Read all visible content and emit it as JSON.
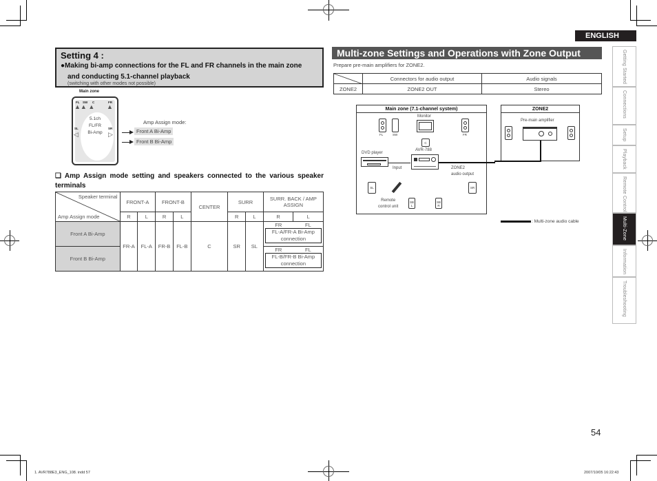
{
  "setting": {
    "title": "Setting 4 :",
    "bullet": "●",
    "line1": "Making bi-amp connections for the FL and FR channels in the main zone",
    "line2": "and conducting 5.1-channel playback",
    "note": "(switching with other modes not possible)"
  },
  "main_zone_mini": {
    "label": "Main zone",
    "speakers": [
      "FL",
      "SW",
      "C",
      "FR",
      "SL",
      "SR"
    ],
    "center_text": [
      "5.1ch",
      "FL/FR",
      "Bi-Amp"
    ]
  },
  "amp_assign": {
    "label": "Amp Assign mode:",
    "options": [
      "Front A Bi-Amp",
      "Front B Bi-Amp"
    ]
  },
  "assign_heading": {
    "checkbox": "❑",
    "text": "Amp Assign mode setting and speakers connected to the various speaker terminals"
  },
  "speaker_table": {
    "corner_top": "Speaker terminal",
    "corner_bottom": "Amp Assign mode",
    "headers": [
      "FRONT-A",
      "FRONT-B",
      "CENTER",
      "SURR",
      "SURR. BACK / AMP ASSIGN"
    ],
    "sub_headers": [
      "R",
      "L",
      "R",
      "L",
      "R",
      "L",
      "R",
      "L"
    ],
    "rows": [
      {
        "mode": "Front A Bi-Amp",
        "sb_r": "FR",
        "sb_l": "FL",
        "connection": "FL-A/FR-A Bi-Amp connection"
      },
      {
        "mode": "Front B Bi-Amp",
        "sb_r": "FR",
        "sb_l": "FL",
        "connection": "FL-B/FR-B Bi-Amp connection"
      }
    ],
    "shared": [
      "FR-A",
      "FL-A",
      "FR-B",
      "FL-B",
      "C",
      "SR",
      "SL"
    ]
  },
  "right": {
    "title": "Multi-zone Settings and Operations with Zone Output",
    "prepare": "Prepare pre-main amplifiers for ZONE2.",
    "zone_table": {
      "headers": [
        "Connectors for audio output",
        "Audio signals"
      ],
      "row": [
        "ZONE2",
        "ZONE2 OUT",
        "Stereo"
      ]
    },
    "diagram": {
      "main_zone_title": "Main zone (7.1-channel system)",
      "zone2_title": "ZONE2",
      "monitor": "Monitor",
      "fl": "FL",
      "sw": "SW",
      "fr": "FR",
      "c": "C",
      "avr": "AVR-788",
      "dvd": "DVD player",
      "input": "Input",
      "zone2_out": [
        "ZONE2",
        "audio output"
      ],
      "sl": "SL",
      "sr": "SR",
      "sbl": "SB L",
      "sbr": "SB R",
      "remote": [
        "Remote",
        "control unit"
      ],
      "pre_main": "Pre-main amplifier"
    },
    "legend": ": Multi-zone audio cable"
  },
  "sidebar": {
    "language": "ENGLISH",
    "items": [
      {
        "label": "Getting Started",
        "active": false
      },
      {
        "label": "Connections",
        "active": false
      },
      {
        "label": "Setup",
        "active": false
      },
      {
        "label": "Playback",
        "active": false
      },
      {
        "label": "Remote Control",
        "active": false
      },
      {
        "label": "Multi-Zone",
        "active": true
      },
      {
        "label": "Information",
        "active": false
      },
      {
        "label": "Troubleshooting",
        "active": false
      }
    ]
  },
  "page_number": "54",
  "footer": {
    "file": "1. AVR788E3_ENG_108. indd    57",
    "date": "2007/10/05    16:22:43"
  }
}
